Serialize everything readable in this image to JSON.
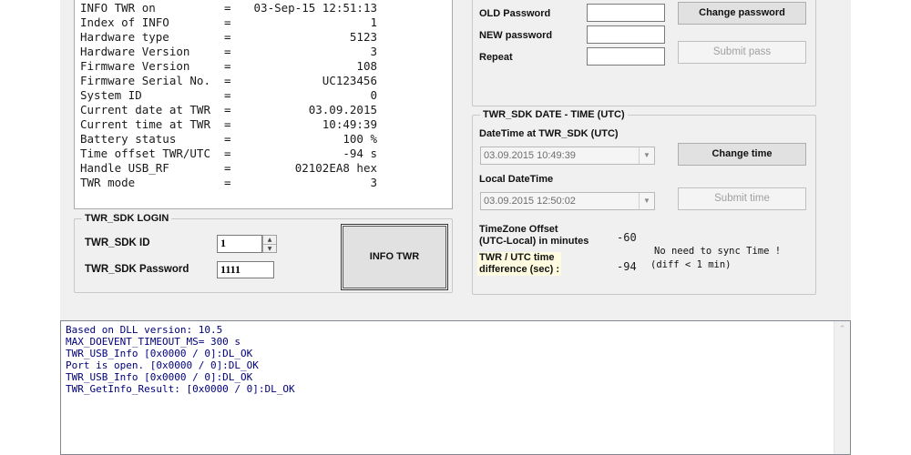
{
  "info": {
    "rows": [
      {
        "key": "INFO TWR on",
        "eq": "=",
        "value": "03-Sep-15 12:51:13"
      },
      {
        "key": "Index of INFO",
        "eq": "=",
        "value": "1"
      },
      {
        "key": "Hardware type",
        "eq": "=",
        "value": "5123"
      },
      {
        "key": "Hardware Version",
        "eq": "=",
        "value": "3"
      },
      {
        "key": "Firmware Version",
        "eq": "=",
        "value": "108"
      },
      {
        "key": "Firmware Serial No.",
        "eq": "=",
        "value": "UC123456"
      },
      {
        "key": "System ID",
        "eq": "=",
        "value": "0"
      },
      {
        "key": "Current date at TWR",
        "eq": "=",
        "value": "03.09.2015"
      },
      {
        "key": "Current time at TWR",
        "eq": "=",
        "value": "10:49:39"
      },
      {
        "key": "Battery status",
        "eq": "=",
        "value": "100 %"
      },
      {
        "key": "Time offset TWR/UTC",
        "eq": "=",
        "value": "-94 s"
      },
      {
        "key": "Handle USB_RF",
        "eq": "=",
        "value": "02102EA8 hex"
      },
      {
        "key": "TWR mode",
        "eq": "=",
        "value": "3"
      }
    ]
  },
  "login": {
    "group_title": "TWR_SDK LOGIN",
    "id_label": "TWR_SDK ID",
    "id_value": "1",
    "password_label": "TWR_SDK Password",
    "password_value": "1111",
    "info_button": "INFO TWR"
  },
  "password": {
    "old_label": "OLD Password",
    "new_label": "NEW password",
    "repeat_label": "Repeat",
    "change_button": "Change password",
    "submit_button": "Submit pass"
  },
  "datetime": {
    "group_title": "TWR_SDK DATE - TIME  (UTC)",
    "twr_label": "DateTime at TWR_SDK (UTC)",
    "twr_value": "03.09.2015 10:49:39",
    "change_button": "Change time",
    "local_label": "Local DateTime",
    "local_value": "03.09.2015 12:50:02",
    "submit_button": "Submit time",
    "tz_label_1": "TimeZone Offset",
    "tz_label_2": "(UTC-Local) in minutes",
    "tz_value": "-60",
    "diff_label_1": "TWR / UTC time",
    "diff_label_2": "difference (sec) :",
    "diff_value": "-94",
    "note_1": "No need to sync Time !",
    "note_2": "(diff < 1 min)"
  },
  "log": {
    "lines": [
      "Based on DLL version: 10.5",
      "MAX_DOEVENT_TIMEOUT_MS= 300 s",
      "TWR_USB_Info [0x0000 / 0]:DL_OK",
      "Port is open. [0x0000 / 0]:DL_OK",
      "TWR_USB_Info [0x0000 / 0]:DL_OK",
      "TWR_GetInfo_Result: [0x0000 / 0]:DL_OK"
    ]
  },
  "icons": {
    "spin_up": "▲",
    "spin_down": "▼",
    "combo_arrow": "▼",
    "scroll_up": "⌃"
  },
  "colors": {
    "window_bg": "#f0f0f0",
    "log_text": "#00007b",
    "disabled_text": "#a0a0a0"
  }
}
